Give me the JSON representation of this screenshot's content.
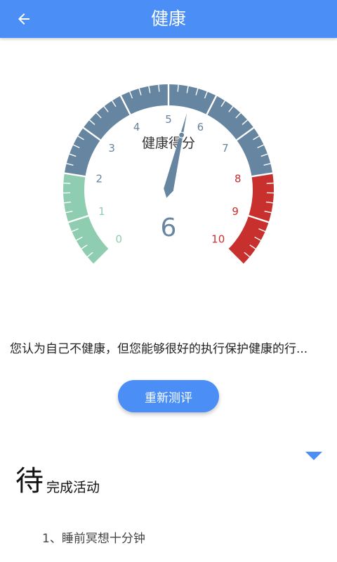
{
  "header": {
    "title": "健康",
    "back_icon": "arrow-left-icon",
    "background_color": "#4a8ef6"
  },
  "gauge": {
    "label": "健康得分",
    "value": 6,
    "value_text": "6",
    "min": 0,
    "max": 10,
    "tick_labels": [
      "0",
      "1",
      "2",
      "3",
      "4",
      "5",
      "6",
      "7",
      "8",
      "9",
      "10"
    ],
    "needle_value": 5.5,
    "zones": [
      {
        "from": 0,
        "to": 2,
        "color": "#8ecdb0"
      },
      {
        "from": 2,
        "to": 8,
        "color": "#6585a1"
      },
      {
        "from": 8,
        "to": 10,
        "color": "#c8302d"
      }
    ]
  },
  "summary": {
    "text": "您认为自己不健康，但您能够很好的执行保护健康的行..."
  },
  "retest_button": {
    "label": "重新测评"
  },
  "pending": {
    "big_char": "待",
    "label": "完成活动",
    "dropdown_icon": "triangle-down-icon"
  },
  "activities": [
    {
      "label": "1、睡前冥想十分钟"
    }
  ]
}
